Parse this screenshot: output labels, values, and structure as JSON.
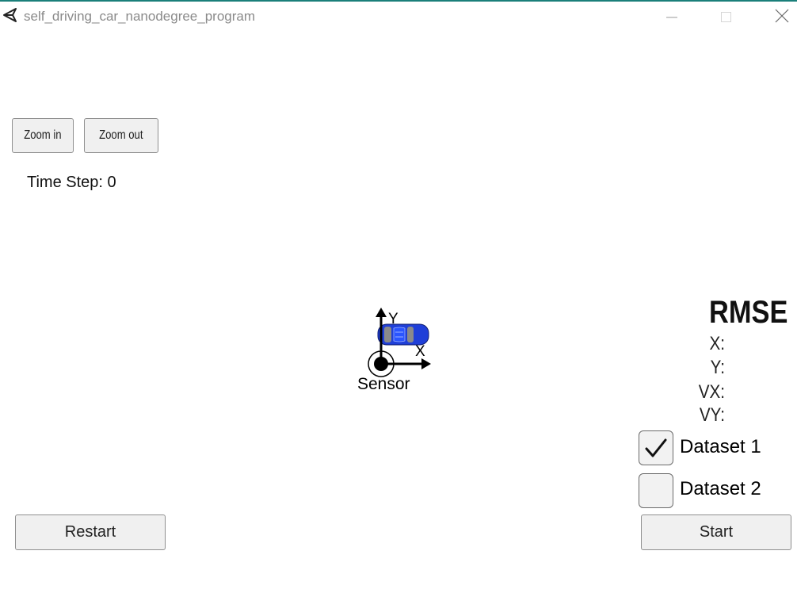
{
  "window": {
    "title": "self_driving_car_nanodegree_program"
  },
  "toolbar": {
    "zoom_in_label": "Zoom in",
    "zoom_out_label": "Zoom out"
  },
  "status": {
    "time_step_text": "Time Step: 0"
  },
  "scene": {
    "sensor_label": "Sensor",
    "axis_x_label": "X",
    "axis_y_label": "Y",
    "car_color": "#1f3fd8"
  },
  "rmse": {
    "title": "RMSE",
    "labels": [
      "X:",
      "Y:",
      "VX:",
      "VY:"
    ]
  },
  "datasets": [
    {
      "label": "Dataset 1",
      "checked": true
    },
    {
      "label": "Dataset 2",
      "checked": false
    }
  ],
  "controls": {
    "restart_label": "Restart",
    "start_label": "Start"
  },
  "colors": {
    "accent_topline": "#1a7f7a",
    "button_bg": "#f0f0f0"
  }
}
